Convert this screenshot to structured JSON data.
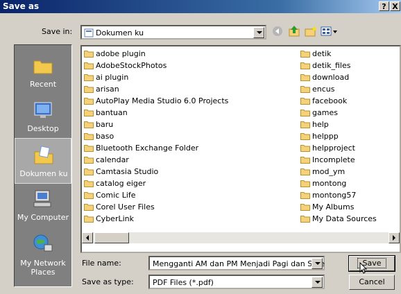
{
  "window": {
    "title": "Save as",
    "help_label": "?",
    "close_label": "X"
  },
  "save_in": {
    "label": "Save in:",
    "value": "Dokumen ku"
  },
  "places": [
    {
      "label": "Recent",
      "icon": "recent-folder-icon"
    },
    {
      "label": "Desktop",
      "icon": "desktop-icon"
    },
    {
      "label": "Dokumen ku",
      "icon": "my-documents-icon",
      "selected": true
    },
    {
      "label": "My Computer",
      "icon": "my-computer-icon"
    },
    {
      "label": "My Network Places",
      "icon": "network-icon"
    }
  ],
  "files": {
    "left": [
      "adobe plugin",
      "AdobeStockPhotos",
      "ai plugin",
      "arisan",
      "AutoPlay Media Studio 6.0 Projects",
      "bantuan",
      "baru",
      "baso",
      "Bluetooth Exchange Folder",
      "calendar",
      "Camtasia Studio",
      "catalog eiger",
      "Comic Life",
      "Corel User Files",
      "CyberLink"
    ],
    "right": [
      "detik",
      "detik_files",
      "download",
      "encus",
      "facebook",
      "games",
      "help",
      "helppp",
      "helpproject",
      "Incomplete",
      "mod_ym",
      "montong",
      "montong57",
      "My Albums",
      "My Data Sources"
    ]
  },
  "file_name": {
    "label": "File name:",
    "value": "Mengganti AM dan PM Menjadi Pagi dan Sore"
  },
  "save_type": {
    "label": "Save as type:",
    "value": "PDF Files (*.pdf)"
  },
  "buttons": {
    "save": "Save",
    "cancel": "Cancel"
  },
  "colors": {
    "titlebar": "#0a246a",
    "folder": "#f5d27a",
    "selection": "#a8a8a8"
  }
}
